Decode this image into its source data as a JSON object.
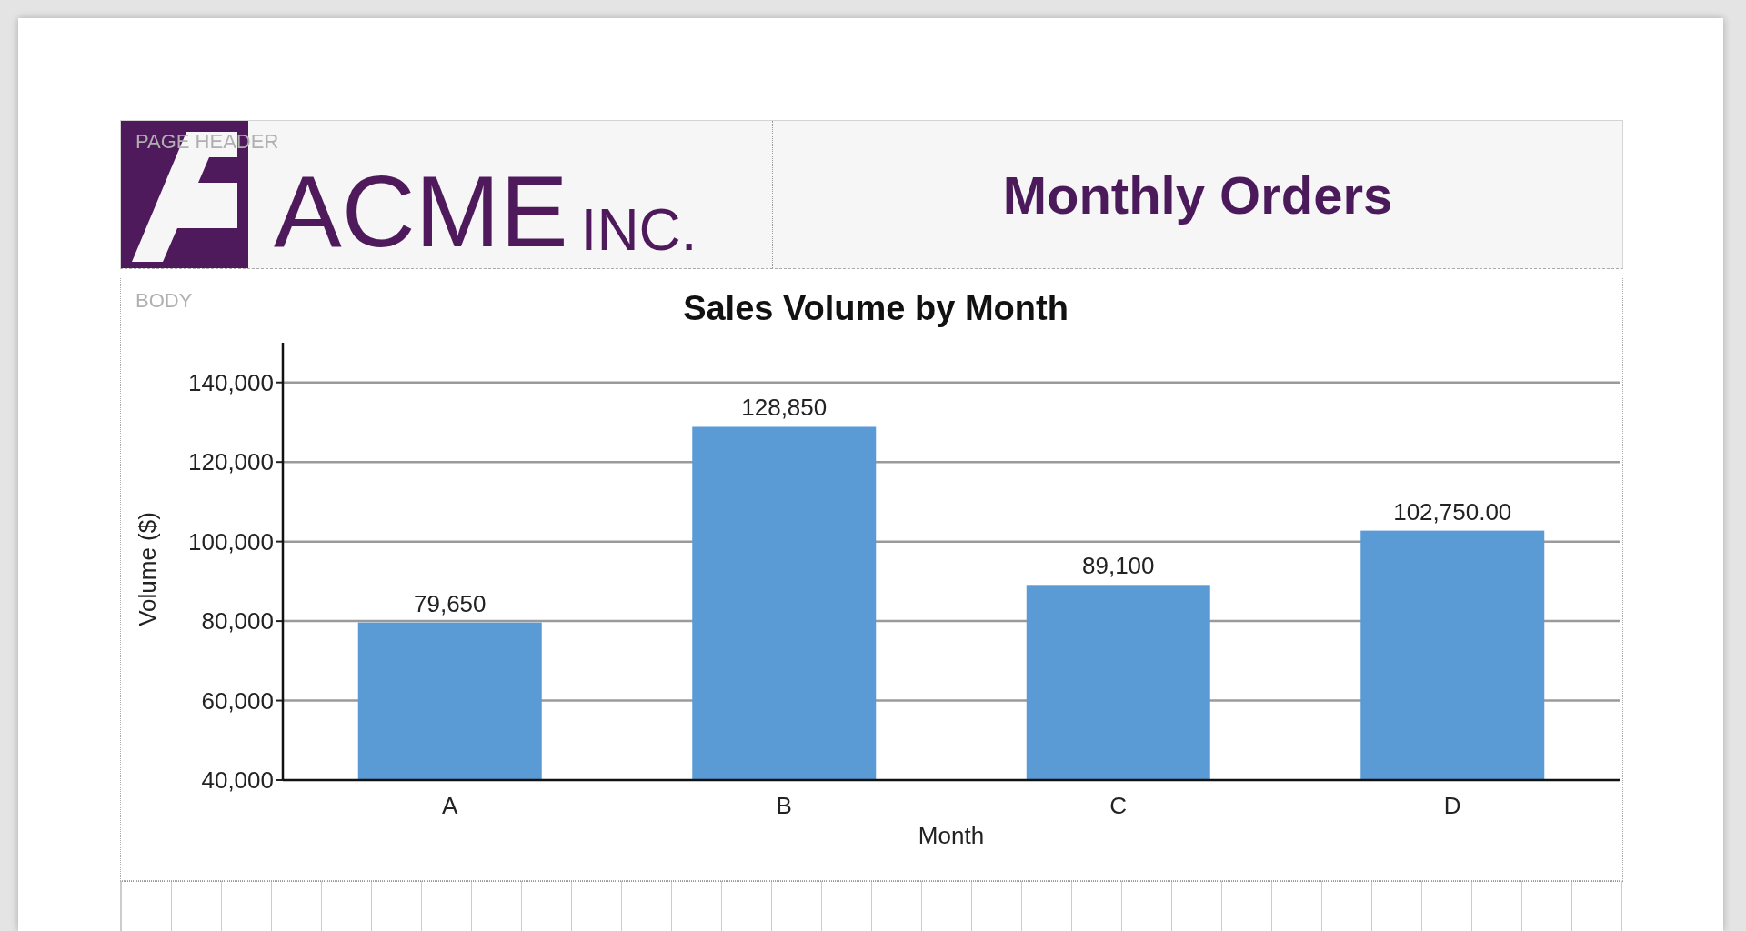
{
  "page_header": {
    "section_label": "PAGE HEADER",
    "logo": {
      "name": "ACME",
      "suffix": "INC."
    },
    "title": "Monthly Orders"
  },
  "body": {
    "section_label": "BODY",
    "chart_data": {
      "type": "bar",
      "title": "Sales Volume by Month",
      "xlabel": "Month",
      "ylabel": "Volume ($)",
      "categories": [
        "A",
        "B",
        "C",
        "D"
      ],
      "grid": true,
      "series": [
        {
          "color": "#5b9bd5",
          "values": [
            79650,
            128850,
            89100,
            102750
          ]
        }
      ],
      "ylim": [
        40000,
        150000
      ],
      "yticks": [
        {
          "value": 40000,
          "label": "40,000"
        },
        {
          "value": 60000,
          "label": "60,000"
        },
        {
          "value": 80000,
          "label": "80,000"
        },
        {
          "value": 100000,
          "label": "100,000"
        },
        {
          "value": 120000,
          "label": "120,000"
        },
        {
          "value": 140000,
          "label": "140,000"
        }
      ],
      "value_labels": [
        "79,650",
        "128,850",
        "89,100",
        "102,750.00"
      ]
    }
  }
}
